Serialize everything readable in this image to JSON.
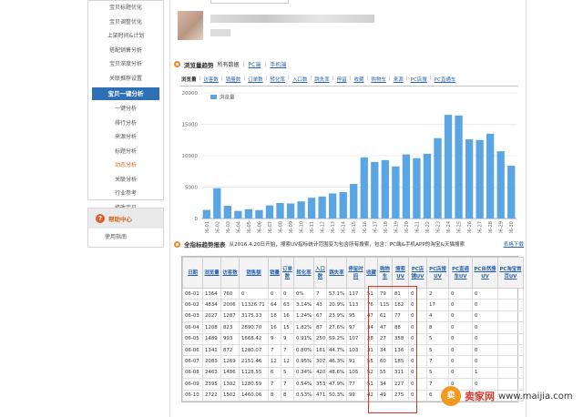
{
  "sidebar": {
    "items_top": [
      "宝贝标题优化",
      "宝贝调整优化",
      "上架时间&计划",
      "搭配销售分析",
      "宝贝深度分析",
      "关联推荐设置"
    ],
    "header": "宝贝一键分析",
    "items_bottom": [
      "一键分析",
      "排行分析",
      "来源分析",
      "标题分析",
      "动态分析",
      "关联分析",
      "行业参考",
      "修改宝贝"
    ],
    "active_item": "动态分析",
    "help": {
      "title": "帮助中心",
      "item": "使用指南"
    }
  },
  "traffic_section": {
    "title": "浏览量趋势",
    "tabs": [
      "所有数据",
      "PC端",
      "手机端"
    ],
    "metrics": [
      "浏览量",
      "访客数",
      "销量数",
      "订单数",
      "转化率",
      "入口数",
      "跳失率",
      "停留",
      "收藏",
      "购物车",
      "来源",
      "PC店搜",
      "PC直通车"
    ]
  },
  "detail_section": {
    "title": "全指标趋势报表",
    "note": "从2016.4.20日开始，搜索UV指标统计范围变为包含所有搜索，包含：PC端&手机APP的淘宝&天猫搜索",
    "download": "表格下载"
  },
  "chart_data": {
    "type": "bar",
    "legend": "浏览量",
    "ylim": [
      0,
      20000
    ],
    "yticks": [
      0,
      5000,
      10000,
      15000,
      20000
    ],
    "color": "#5aa5e3",
    "categories": [
      "06-01",
      "06-02",
      "06-03",
      "06-04",
      "06-05",
      "06-06",
      "06-07",
      "06-08",
      "06-09",
      "06-10",
      "06-11",
      "06-12",
      "06-13",
      "06-14",
      "06-15",
      "06-16",
      "06-17",
      "06-18",
      "06-19",
      "06-20",
      "06-21",
      "06-22",
      "06-23",
      "06-24",
      "06-25",
      "06-26",
      "06-27",
      "06-28",
      "06-29",
      "06-30"
    ],
    "values": [
      1364,
      4834,
      2027,
      1208,
      1489,
      1341,
      2083,
      2463,
      2395,
      2722,
      3300,
      3500,
      4000,
      4200,
      5500,
      9700,
      9000,
      9300,
      8300,
      10200,
      9600,
      10300,
      12800,
      16500,
      16400,
      12600,
      12500,
      13500,
      10700,
      8400
    ]
  },
  "table": {
    "headers": [
      "日期",
      "浏览量",
      "访客数",
      "销售额",
      "销量",
      "订单数",
      "转化率",
      "入口数",
      "跳失率",
      "停留时间",
      "收藏",
      "购物车",
      "搜索UV",
      "PC店铺UV",
      "PC店搜UV",
      "PC直通车UV",
      "PC自然搜UV",
      "PC淘宝首页UV"
    ],
    "rows": [
      [
        "06-01",
        "1364",
        "760",
        "0",
        "0",
        "0",
        "0%",
        "7",
        "57.1%",
        "117",
        "51",
        "79",
        "81",
        "0",
        "2",
        "0",
        "0",
        ""
      ],
      [
        "06-02",
        "4834",
        "2006",
        "11326.71",
        "64",
        "63",
        "3.14%",
        "43",
        "20.9%",
        "113",
        "76",
        "115",
        "182",
        "0",
        "17",
        "0",
        "0",
        ""
      ],
      [
        "06-03",
        "2027",
        "1287",
        "3175.33",
        "18",
        "16",
        "1.24%",
        "67",
        "23.9%",
        "95",
        "47",
        "61",
        "77",
        "0",
        "4",
        "0",
        "0",
        ""
      ],
      [
        "06-04",
        "1208",
        "823",
        "2890.70",
        "16",
        "15",
        "1.82%",
        "87",
        "27.6%",
        "97",
        "34",
        "47",
        "88",
        "0",
        "8",
        "0",
        "0",
        ""
      ],
      [
        "06-05",
        "1489",
        "993",
        "1668.42",
        "9",
        "9",
        "0.91%",
        "250",
        "59.2%",
        "107",
        "28",
        "27",
        "358",
        "0",
        "5",
        "0",
        "0",
        ""
      ],
      [
        "06-06",
        "1341",
        "872",
        "1280.07",
        "7",
        "7",
        "0.80%",
        "161",
        "44.7%",
        "103",
        "31",
        "34",
        "136",
        "0",
        "5",
        "0",
        "0",
        ""
      ],
      [
        "06-07",
        "2083",
        "1269",
        "2151.46",
        "12",
        "12",
        "0.95%",
        "307",
        "46.3%",
        "91",
        "55",
        "60",
        "185",
        "0",
        "7",
        "0",
        "0",
        ""
      ],
      [
        "06-08",
        "2463",
        "1486",
        "1128.55",
        "6",
        "5",
        "0.34%",
        "420",
        "48.6%",
        "105",
        "52",
        "55",
        "311",
        "0",
        "5",
        "0",
        "1",
        ""
      ],
      [
        "06-09",
        "2395",
        "1302",
        "1280.59",
        "7",
        "7",
        "0.54%",
        "353",
        "47.9%",
        "77",
        "51",
        "34",
        "227",
        "0",
        "7",
        "0",
        "0",
        ""
      ],
      [
        "06-10",
        "2722",
        "1502",
        "1460.06",
        "8",
        "8",
        "0.53%",
        "471",
        "50.3%",
        "99",
        "42",
        "49",
        "275",
        "0",
        "6",
        "0",
        "0",
        ""
      ]
    ]
  },
  "watermark": {
    "logo": "卖",
    "name": "卖家网",
    "url": "www.maijia.com"
  }
}
